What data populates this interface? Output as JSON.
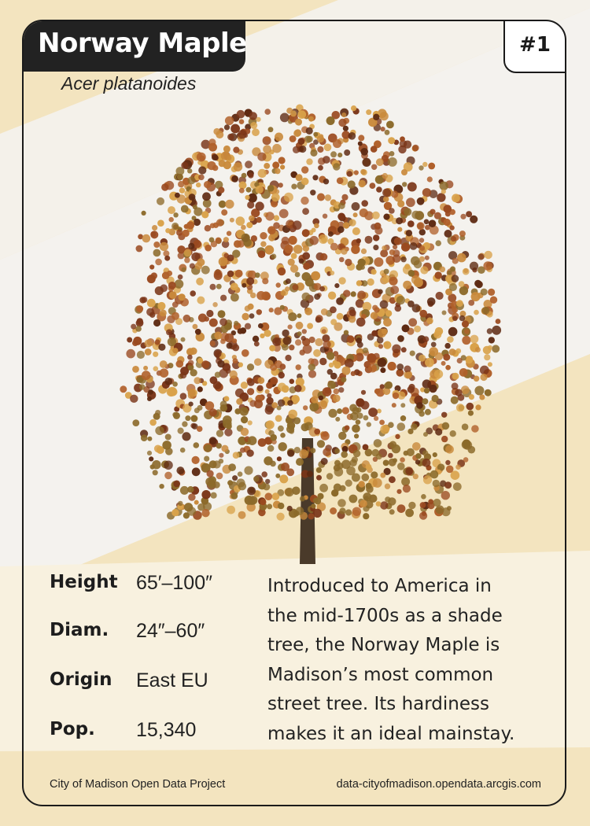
{
  "card": {
    "common_name": "Norway Maple",
    "scientific_name": "Acer platanoides",
    "rank": "#1",
    "stats": [
      {
        "label": "Height",
        "value": "65′–100″"
      },
      {
        "label": "Diam.",
        "value": "24″–60″"
      },
      {
        "label": "Origin",
        "value": "East EU"
      },
      {
        "label": "Pop.",
        "value": "15,340"
      }
    ],
    "description_lines": [
      "Introduced to America in",
      "the mid-1700s as a shade",
      "tree, the Norway Maple is",
      "Madison’s most common",
      "street tree. Its hardiness",
      "makes it an ideal mainstay."
    ],
    "footer_left": "City of Madison Open Data Project",
    "footer_right": "data-cityofmadison.opendata.arcgis.com"
  },
  "colors": {
    "background_cream": "#f3e4bf",
    "band_light": "#f4f2ee",
    "panel_light": "#f8f1df",
    "ink": "#1d1d1d",
    "foliage_dark": "#7a3518",
    "foliage_mid": "#b0602a",
    "foliage_light": "#d9a24a",
    "foliage_low": "#8c6a2a"
  }
}
